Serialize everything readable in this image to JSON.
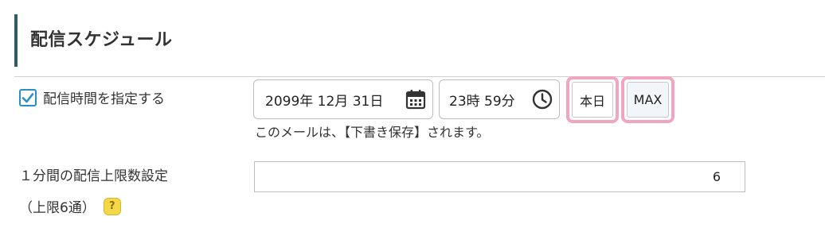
{
  "section": {
    "title": "配信スケジュール"
  },
  "schedule": {
    "checkbox_label": "配信時間を指定する",
    "checked": true,
    "date_value": "2099年 12月 31日",
    "time_value": "23時 59分",
    "today_label": "本日",
    "max_label": "MAX",
    "note": "このメールは、【下書き保存】されます。"
  },
  "limit": {
    "label": "１分間の配信上限数設定",
    "sub_label": "（上限6通）",
    "help_icon_text": "?",
    "value": "6"
  },
  "colors": {
    "accent": "#2b8fc7",
    "section_bar": "#2f5d62",
    "highlight": "#f2a5c0",
    "help_icon": "#f5d84a"
  },
  "icons": {
    "date": "calendar-icon",
    "time": "clock-icon",
    "help": "help-icon"
  }
}
